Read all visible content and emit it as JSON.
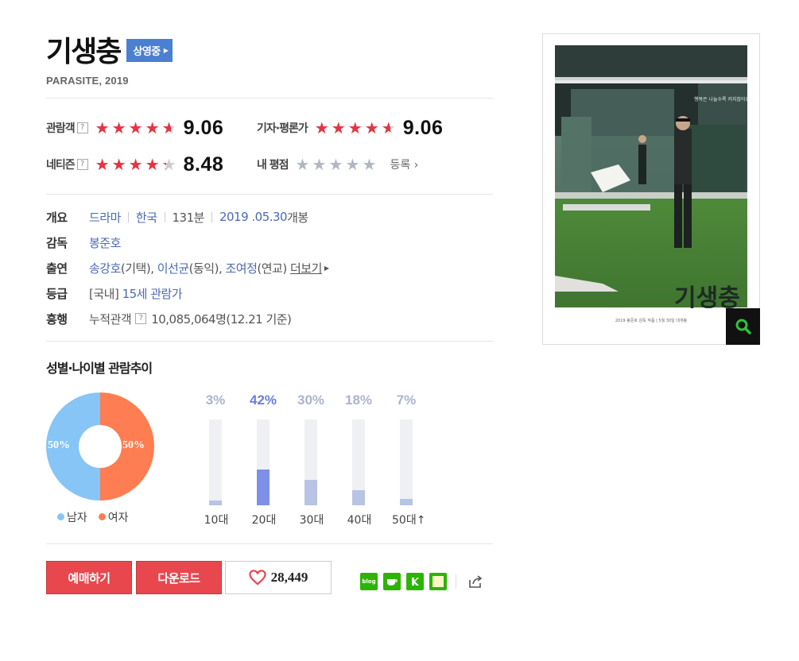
{
  "movie": {
    "title": "기생충",
    "status_badge": "상영중",
    "subtitle": "PARASITE, 2019"
  },
  "ratings": {
    "audience": {
      "label": "관람객",
      "help": "?",
      "score": "9.06",
      "value": 9.06
    },
    "critics": {
      "label": "기자·평론가",
      "score": "9.06",
      "value": 9.06
    },
    "netizen": {
      "label": "네티즌",
      "help": "?",
      "score": "8.48",
      "value": 8.48
    },
    "my_rating": {
      "label": "내 평점",
      "register": "등록 ›",
      "value": 0
    }
  },
  "info": {
    "overview": {
      "label": "개요",
      "genre": "드라마",
      "country": "한국",
      "runtime": "131분",
      "release_date": "2019 .05.30",
      "release_suffix": " 개봉"
    },
    "director": {
      "label": "감독",
      "name": "봉준호"
    },
    "cast": {
      "label": "출연",
      "actors": [
        {
          "name": "송강호",
          "role": "(기택), "
        },
        {
          "name": "이선균",
          "role": "(동익), "
        },
        {
          "name": "조여정",
          "role": "(연교) "
        }
      ],
      "more": "더보기"
    },
    "grade": {
      "label": "등급",
      "prefix": "[국내] ",
      "value": "15세 관람가"
    },
    "box_office": {
      "label": "흥행",
      "text": "누적관객",
      "help": "?",
      "value": "10,085,064명(12.21 기준)"
    }
  },
  "chart_section": {
    "title": "성별·나이별 관람추이",
    "gender": {
      "male_label": "남자",
      "female_label": "여자",
      "male_pct": "50%",
      "female_pct": "50%",
      "male_color": "#86c5f6",
      "female_color": "#fe7d52"
    },
    "age_groups": [
      {
        "label": "10대",
        "pct": "3%",
        "value": 3
      },
      {
        "label": "20대",
        "pct": "42%",
        "value": 42,
        "highlight": true
      },
      {
        "label": "30대",
        "pct": "30%",
        "value": 30
      },
      {
        "label": "40대",
        "pct": "18%",
        "value": 18
      },
      {
        "label": "50대↑",
        "pct": "7%",
        "value": 7
      }
    ]
  },
  "chart_data": [
    {
      "type": "pie",
      "categories": [
        "남자",
        "여자"
      ],
      "values": [
        50,
        50
      ]
    },
    {
      "type": "bar",
      "categories": [
        "10대",
        "20대",
        "30대",
        "40대",
        "50대↑"
      ],
      "values": [
        3,
        42,
        30,
        18,
        7
      ],
      "ylim": [
        0,
        100
      ]
    }
  ],
  "actions": {
    "reserve": "예매하기",
    "download": "다운로드",
    "like_count": "28,449"
  },
  "share": {
    "blog": "blog"
  },
  "poster": {
    "title_text": "기생충",
    "tagline": "행복은 나눌수록 커지잖아요",
    "credits": "2019 봉준호 감독 작품 | 5월 30일 대개봉"
  },
  "colors": {
    "star_red": "#e83340",
    "accent_blue": "#4b7fd1",
    "button_red": "#e8474e"
  }
}
